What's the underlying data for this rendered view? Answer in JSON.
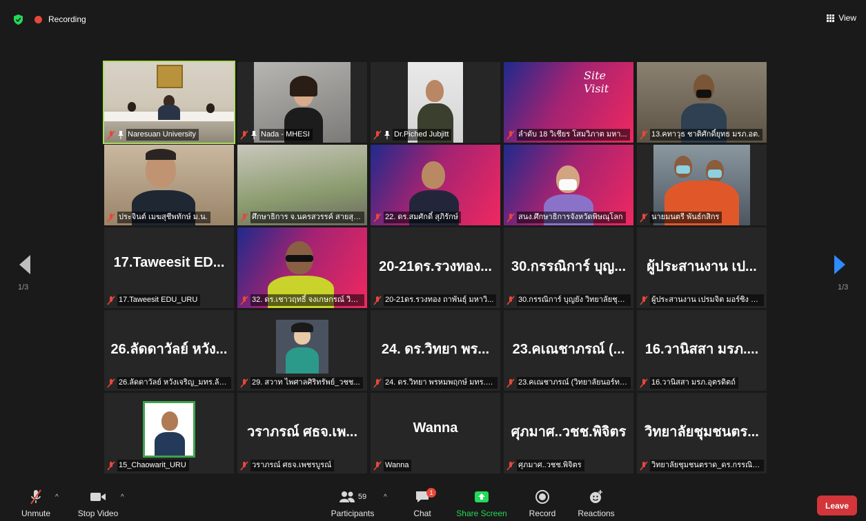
{
  "topbar": {
    "recording_label": "Recording",
    "view_label": "View"
  },
  "pagination": {
    "left": "1/3",
    "right": "1/3"
  },
  "tiles": [
    {
      "caption": "Naresuan University",
      "big": "",
      "pinned": true
    },
    {
      "caption": "Nada - MHESI",
      "big": "",
      "pinned": true
    },
    {
      "caption": "Dr.Piched Jubjitt",
      "big": "",
      "pinned": true
    },
    {
      "caption": "ลำดับ 18 วิเชียร โสมวิภาต มหา...",
      "big": ""
    },
    {
      "caption": "13.คทาวุธ ชาติศักดิ์ยุทธ มรภ.อต.",
      "big": ""
    },
    {
      "caption": "ประจินต์ เมฆสุชีพทักษ์ ม.น.",
      "big": ""
    },
    {
      "caption": "ศึกษาธิการ จ.นครสวรรค์ สายสุนี...",
      "big": ""
    },
    {
      "caption": "22. ดร.สมศักดิ์ สุภิรักษ์",
      "big": ""
    },
    {
      "caption": "สนง.ศึกษาธิการจังหวัดพิษณุโลก",
      "big": ""
    },
    {
      "caption": "นายมนตรี พันธ์กสิกร",
      "big": ""
    },
    {
      "caption": "17.Taweesit EDU_URU",
      "big": "17.Taweesit ED..."
    },
    {
      "caption": "32. ดร.เชาวฤทธิ์ จงเกษกรณ์ วิทยาลั...",
      "big": ""
    },
    {
      "caption": "20-21ดร.รวงทอง ถาพันธุ์ มหาวิ...",
      "big": "20-21ดร.รวงทอง..."
    },
    {
      "caption": "30.กรรณิการ์ บุญยัง วิทยาลัยชุม...",
      "big": "30.กรรณิการ์ บุญ..."
    },
    {
      "caption": "ผู้ประสานงาน เปรมจิต มอร์ซิง วิท...",
      "big": "ผู้ประสานงาน เป..."
    },
    {
      "caption": "26.ลัดดาวัลย์ หวังเจริญ_มทร.ล้าน...",
      "big": "26.ลัดดาวัลย์ หวัง..."
    },
    {
      "caption": "29. สวาท ไพศาลศิริทรัพย์_วชช...",
      "big": ""
    },
    {
      "caption": "24. ดร.วิทยา พรหมพฤกษ์ มทร.ล้...",
      "big": "24. ดร.วิทยา พร..."
    },
    {
      "caption": "23.คเณชาภรณ์ (วิทยาลัยนอร์ทเท...",
      "big": "23.คเณชาภรณ์ (..."
    },
    {
      "caption": "16.วานิสสา มรภ.อุตรดิตถ์",
      "big": "16.วานิสสา มรภ...."
    },
    {
      "caption": "15_Chaowarit_URU",
      "big": ""
    },
    {
      "caption": "วราภรณ์ ศธจ.เพชรบูรณ์",
      "big": "วราภรณ์ ศธจ.เพ..."
    },
    {
      "caption": "Wanna",
      "big": "Wanna"
    },
    {
      "caption": "ศุภมาศ..วชช.พิจิตร",
      "big": "ศุภมาศ..วชช.พิจิตร"
    },
    {
      "caption": "วิทยาลัยชุมชนตราด_ดร.กรรณิกา...",
      "big": "วิทยาลัยชุมชนตร..."
    }
  ],
  "toolbar": {
    "unmute": "Unmute",
    "stop_video": "Stop Video",
    "participants": "Participants",
    "participants_count": "59",
    "chat": "Chat",
    "chat_badge": "1",
    "share_screen": "Share Screen",
    "record": "Record",
    "reactions": "Reactions",
    "leave": "Leave"
  },
  "colors": {
    "share_green": "#23d959",
    "leave_red": "#d2353a",
    "active_border": "#a8e05f",
    "arrow_blue": "#2d8cff"
  }
}
